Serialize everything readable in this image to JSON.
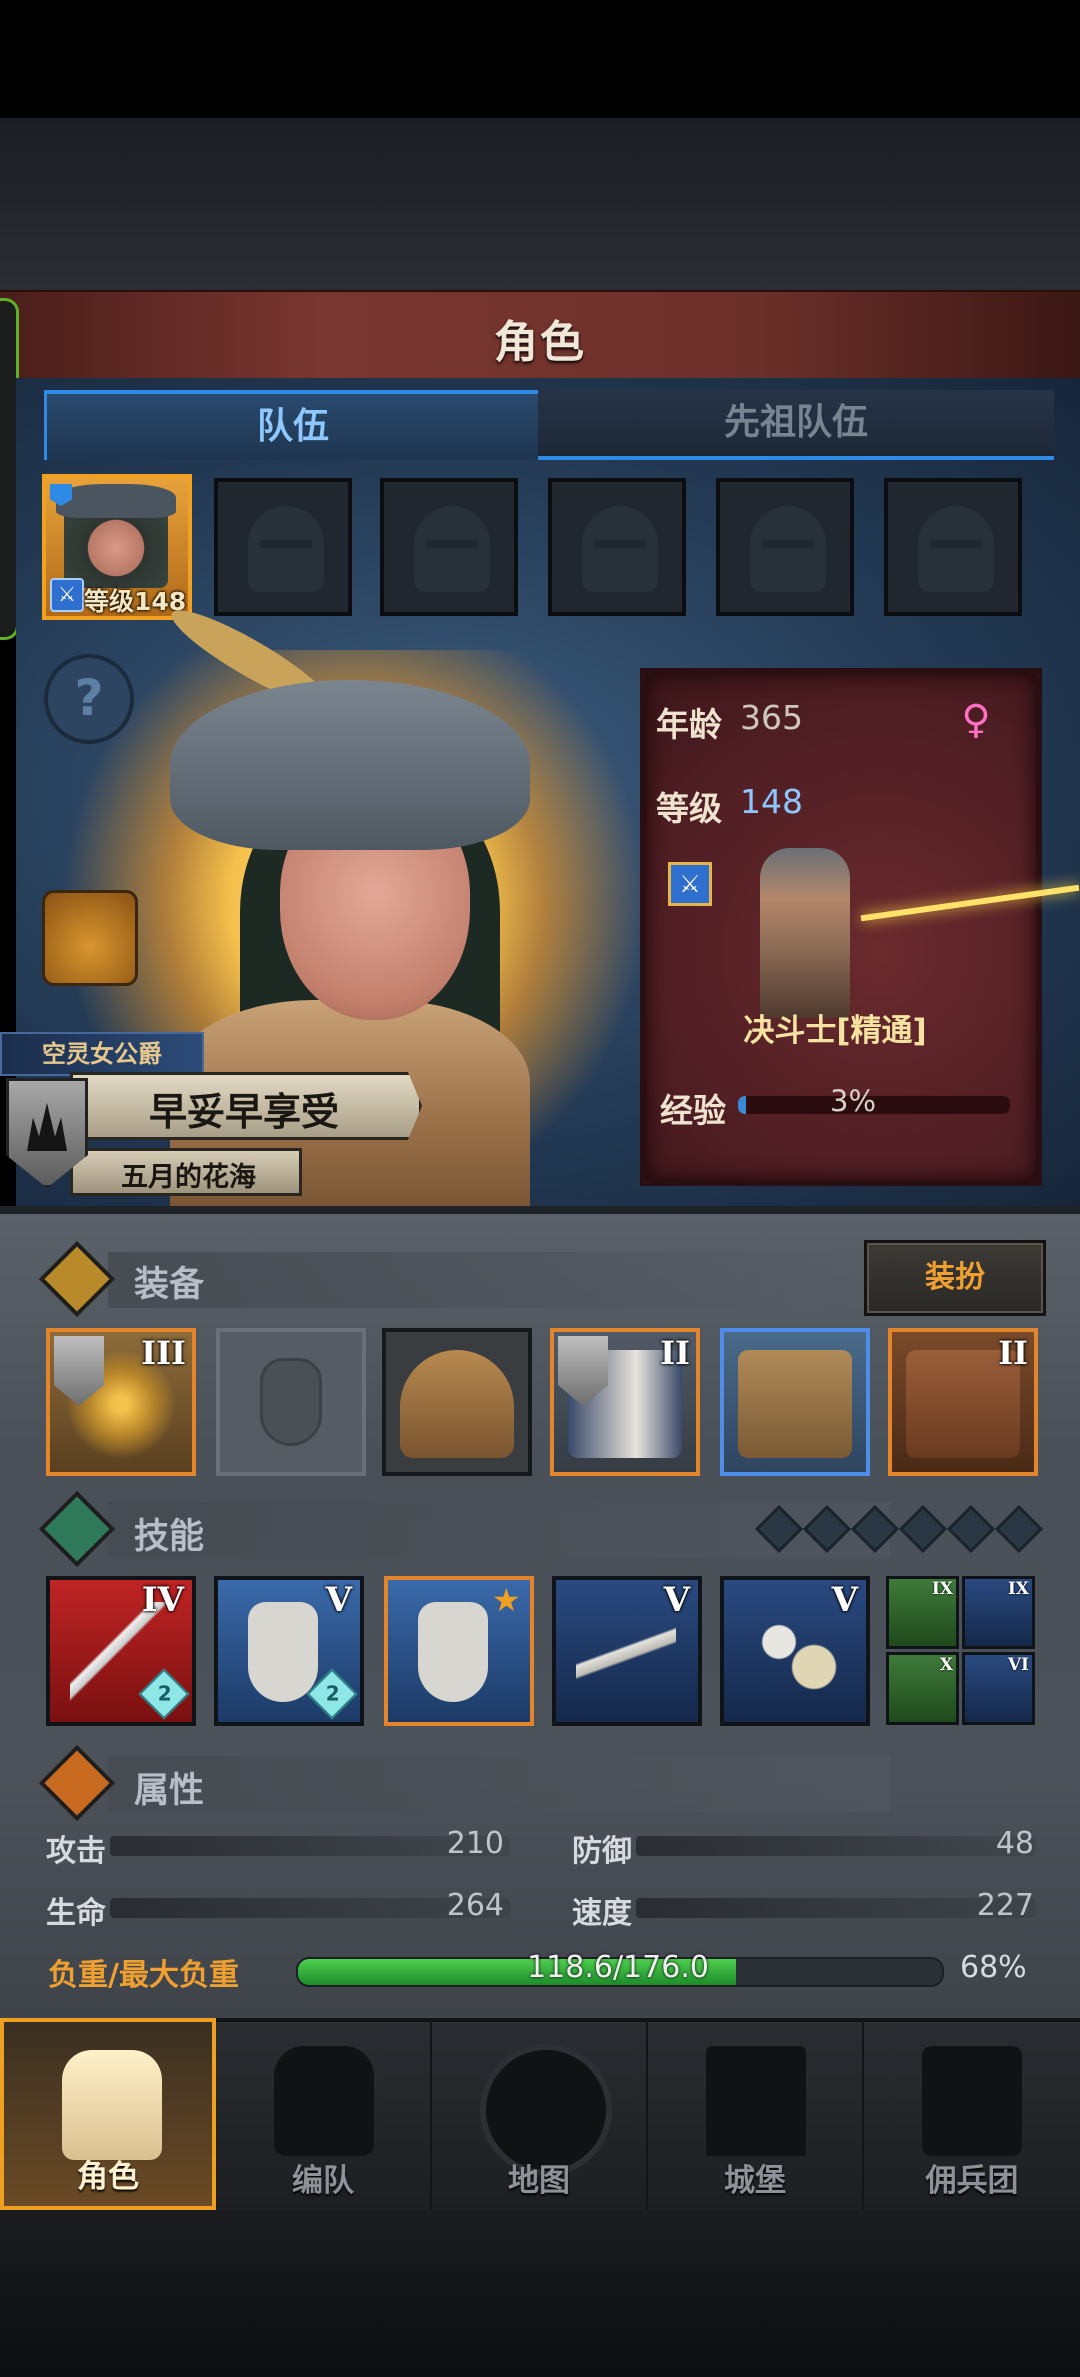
{
  "header": {
    "title": "角色"
  },
  "tabs": [
    {
      "label": "队伍",
      "active": true
    },
    {
      "label": "先祖队伍",
      "active": false
    }
  ],
  "roster": {
    "selected_level_text": "等级148",
    "empty_slot_count": 5
  },
  "hero": {
    "title": "空灵女公爵",
    "name": "早妥早享受",
    "guild": "五月的花海"
  },
  "info": {
    "age_label": "年龄",
    "age_value": "365",
    "level_label": "等级",
    "level_value": "148",
    "gender_symbol": "♀",
    "class_name": "决斗士[精通]",
    "exp_label": "经验",
    "exp_percent": 3,
    "exp_text": "3%"
  },
  "equipment": {
    "section_title": "装备",
    "dress_label": "装扮",
    "slots": [
      {
        "icon": "golden-weapon-icon",
        "tier": "III",
        "badge": true
      },
      {
        "icon": "empty-shield-slot-icon",
        "tier": "",
        "badge": false
      },
      {
        "icon": "helmet-icon",
        "tier": "",
        "badge": false
      },
      {
        "icon": "fur-armor-icon",
        "tier": "II",
        "badge": true
      },
      {
        "icon": "boots-icon",
        "tier": "",
        "badge": false
      },
      {
        "icon": "book-icon",
        "tier": "II",
        "badge": false
      }
    ]
  },
  "skills": {
    "section_title": "技能",
    "slots": [
      {
        "icon": "sword-strike-icon",
        "tier": "IV",
        "gem": "2"
      },
      {
        "icon": "shield-sword-icon",
        "tier": "V",
        "gem": "2"
      },
      {
        "icon": "shield-sword-star-icon",
        "tier": "",
        "gem": ""
      },
      {
        "icon": "blade-slash-icon",
        "tier": "V",
        "gem": ""
      },
      {
        "icon": "crystal-bird-icon",
        "tier": "V",
        "gem": ""
      }
    ],
    "mini": [
      {
        "tier": "IX"
      },
      {
        "tier": "IX"
      },
      {
        "tier": "X"
      },
      {
        "tier": "VI"
      }
    ]
  },
  "attributes": {
    "section_title": "属性",
    "attack_label": "攻击",
    "attack_value": "210",
    "defense_label": "防御",
    "defense_value": "48",
    "hp_label": "生命",
    "hp_value": "264",
    "speed_label": "速度",
    "speed_value": "227",
    "load_label": "负重/最大负重",
    "load_text": "118.6/176.0",
    "load_percent_text": "68%",
    "load_fraction": 0.68
  },
  "nav": [
    {
      "label": "角色",
      "active": true
    },
    {
      "label": "编队",
      "active": false
    },
    {
      "label": "地图",
      "active": false
    },
    {
      "label": "城堡",
      "active": false
    },
    {
      "label": "佣兵团",
      "active": false
    }
  ],
  "colors": {
    "accent": "#f0a020",
    "tab_blue": "#2f8ae6",
    "load_green": "#2fae38",
    "title_red": "#6c302a"
  }
}
